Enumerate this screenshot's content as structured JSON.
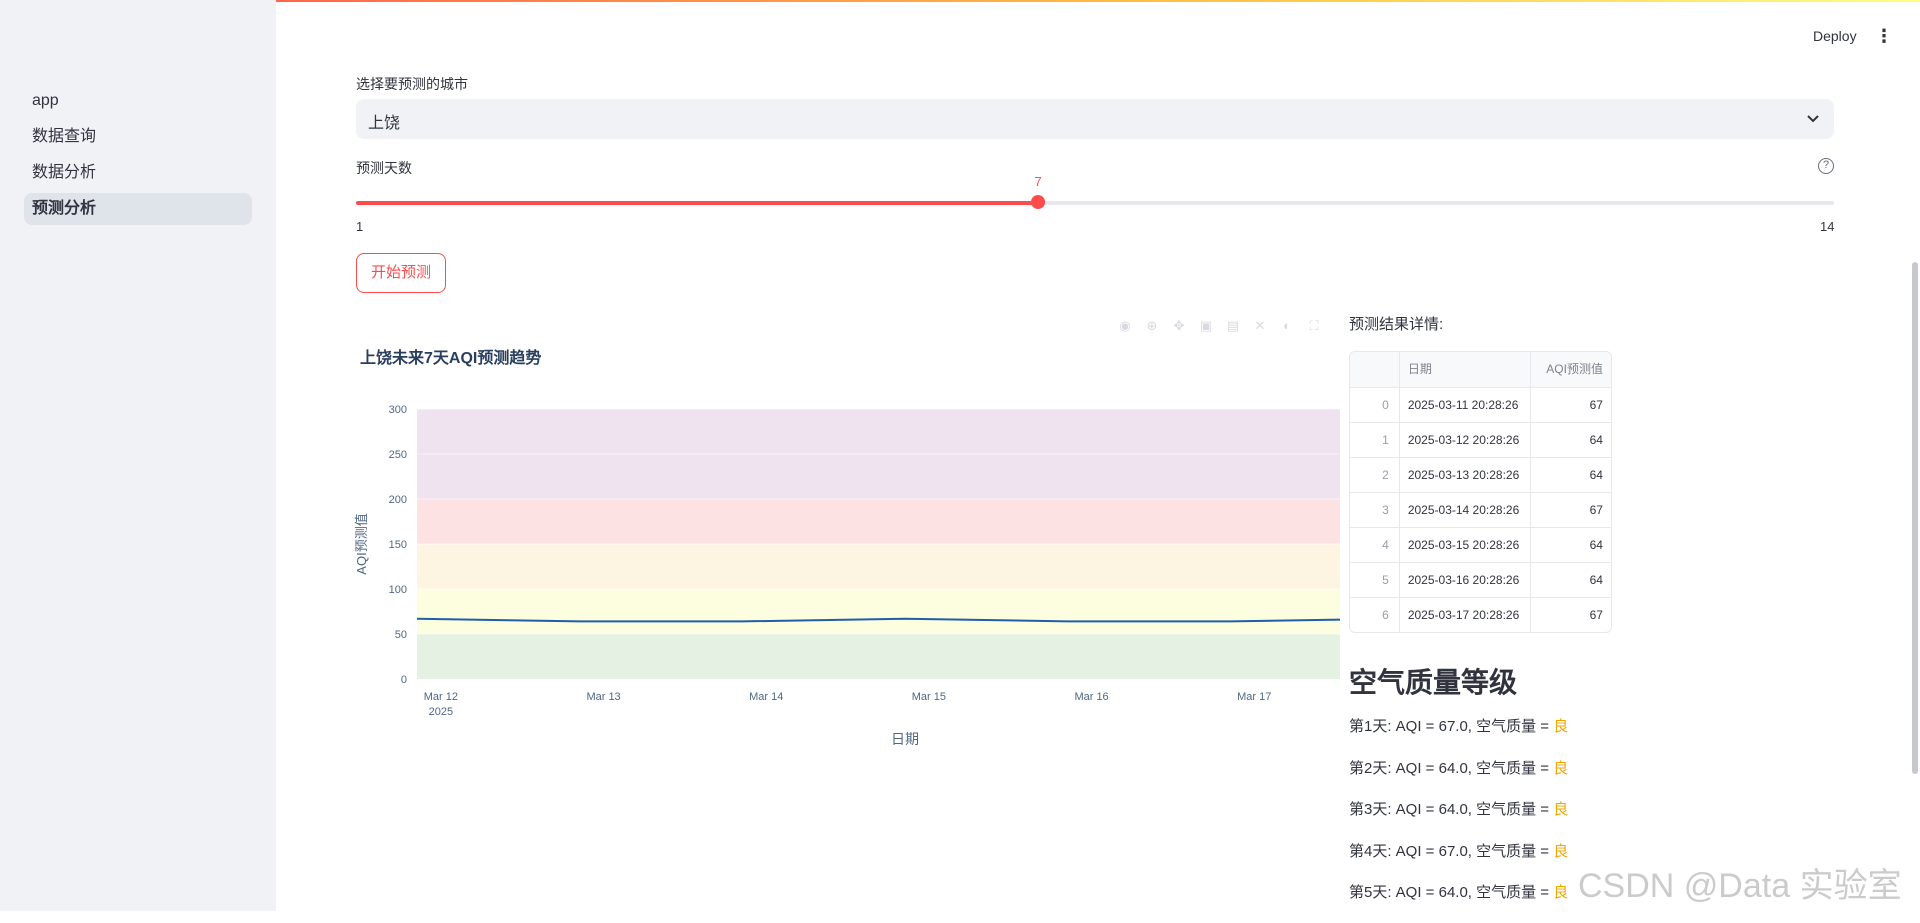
{
  "sidebar": {
    "items": [
      {
        "label": "app",
        "active": false
      },
      {
        "label": "数据查询",
        "active": false
      },
      {
        "label": "数据分析",
        "active": false
      },
      {
        "label": "预测分析",
        "active": true
      }
    ]
  },
  "header": {
    "deploy_label": "Deploy",
    "menu_icon": "kebab-menu-icon"
  },
  "city_select": {
    "label": "选择要预测的城市",
    "value": "上饶",
    "icon": "chevron-down-icon"
  },
  "days_slider": {
    "label": "预测天数",
    "value": 7,
    "value_text": "7",
    "min": 1,
    "max": 14,
    "min_text": "1",
    "max_text": "14",
    "help_icon": "question-circle-icon",
    "accent": "#ff4b4b"
  },
  "predict_button": {
    "label": "开始预测"
  },
  "chart_modebar": {
    "icons": [
      "camera-icon",
      "zoom-icon",
      "pan-icon",
      "box-select-icon",
      "lasso-icon",
      "zoom-in-icon",
      "zoom-out-icon",
      "autoscale-icon",
      "reset-icon"
    ]
  },
  "chart_data": {
    "type": "line",
    "title": "上饶未来7天AQI预测趋势",
    "xlabel": "日期",
    "ylabel": "AQI预测值",
    "x": [
      "2025-03-11 20:28:26",
      "2025-03-12 20:28:26",
      "2025-03-13 20:28:26",
      "2025-03-14 20:28:26",
      "2025-03-15 20:28:26",
      "2025-03-16 20:28:26",
      "2025-03-17 20:28:26"
    ],
    "x_ticks": [
      "Mar 12",
      "Mar 13",
      "Mar 14",
      "Mar 15",
      "Mar 16",
      "Mar 17"
    ],
    "x_tick_sub": "2025",
    "series": [
      {
        "values": [
          67,
          64,
          64,
          67,
          64,
          64,
          67
        ],
        "color": "#1f5fa8"
      }
    ],
    "ylim": [
      0,
      300
    ],
    "y_ticks": [
      0,
      50,
      100,
      150,
      200,
      250,
      300
    ],
    "bands": [
      {
        "from": 0,
        "to": 50,
        "color": "#e5f2e3"
      },
      {
        "from": 50,
        "to": 100,
        "color": "#fdfde0"
      },
      {
        "from": 100,
        "to": 150,
        "color": "#fdf4e2"
      },
      {
        "from": 150,
        "to": 200,
        "color": "#fde2e4"
      },
      {
        "from": 200,
        "to": 300,
        "color": "#f0e3f0"
      }
    ],
    "grid": true,
    "legend": "none"
  },
  "results": {
    "heading": "预测结果详情:",
    "columns": [
      "",
      "日期",
      "AQI预测值"
    ],
    "rows": [
      [
        "0",
        "2025-03-11 20:28:26",
        "67"
      ],
      [
        "1",
        "2025-03-12 20:28:26",
        "64"
      ],
      [
        "2",
        "2025-03-13 20:28:26",
        "64"
      ],
      [
        "3",
        "2025-03-14 20:28:26",
        "67"
      ],
      [
        "4",
        "2025-03-15 20:28:26",
        "64"
      ],
      [
        "5",
        "2025-03-16 20:28:26",
        "64"
      ],
      [
        "6",
        "2025-03-17 20:28:26",
        "67"
      ]
    ]
  },
  "air_quality": {
    "heading": "空气质量等级",
    "grade_color": "#f0a500",
    "items": [
      {
        "text": "第1天: AQI = 67.0, 空气质量 = ",
        "grade": "良"
      },
      {
        "text": "第2天: AQI = 64.0, 空气质量 = ",
        "grade": "良"
      },
      {
        "text": "第3天: AQI = 64.0, 空气质量 = ",
        "grade": "良"
      },
      {
        "text": "第4天: AQI = 67.0, 空气质量 = ",
        "grade": "良"
      },
      {
        "text": "第5天: AQI = 64.0, 空气质量 = ",
        "grade": "良"
      }
    ]
  },
  "watermark": "CSDN @Data 实验室"
}
